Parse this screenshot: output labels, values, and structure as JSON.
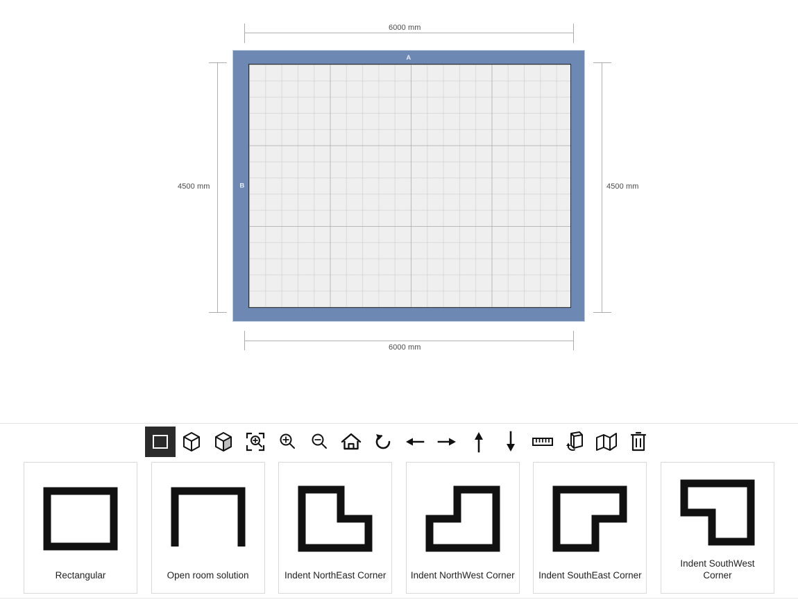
{
  "plan": {
    "dimensions": {
      "top": "6000 mm",
      "bottom": "6000 mm",
      "left": "4500 mm",
      "right": "4500 mm"
    },
    "wall_labels": {
      "top": "A",
      "left": "B"
    },
    "colors": {
      "wall": "#6d88b2",
      "floor": "#efefef",
      "outline": "#2a2d33",
      "dimension_line": "#b0b0b0",
      "dimension_text": "#4a4a4a"
    }
  },
  "toolbar": {
    "items": [
      {
        "name": "2d-view-icon",
        "title": "2D View",
        "active": true
      },
      {
        "name": "3d-wireframe-icon",
        "title": "3D Wireframe",
        "active": false
      },
      {
        "name": "3d-solid-icon",
        "title": "3D Solid",
        "active": false
      },
      {
        "name": "zoom-to-fit-icon",
        "title": "Zoom To Fit",
        "active": false
      },
      {
        "name": "zoom-in-icon",
        "title": "Zoom In",
        "active": false
      },
      {
        "name": "zoom-out-icon",
        "title": "Zoom Out",
        "active": false
      },
      {
        "name": "home-icon",
        "title": "Home View",
        "active": false
      },
      {
        "name": "rotate-icon",
        "title": "Rotate",
        "active": false
      },
      {
        "name": "arrow-left-icon",
        "title": "Move Left",
        "active": false
      },
      {
        "name": "arrow-right-icon",
        "title": "Move Right",
        "active": false
      },
      {
        "name": "arrow-up-icon",
        "title": "Move Up",
        "active": false
      },
      {
        "name": "arrow-down-icon",
        "title": "Move Down",
        "active": false
      },
      {
        "name": "ruler-icon",
        "title": "Measure",
        "active": false
      },
      {
        "name": "flip-object-icon",
        "title": "Flip Object",
        "active": false
      },
      {
        "name": "unfold-walls-icon",
        "title": "Unfold Walls",
        "active": false
      },
      {
        "name": "trash-icon",
        "title": "Delete",
        "active": false
      }
    ]
  },
  "palette": {
    "shapes": [
      {
        "name": "rectangular",
        "label": "Rectangular",
        "glyph": "rect"
      },
      {
        "name": "open-room-solution",
        "label": "Open room solution",
        "glyph": "open"
      },
      {
        "name": "indent-northeast-corner",
        "label": "Indent NorthEast Corner",
        "glyph": "indent-ne"
      },
      {
        "name": "indent-northwest-corner",
        "label": "Indent NorthWest Corner",
        "glyph": "indent-nw"
      },
      {
        "name": "indent-southeast-corner",
        "label": "Indent SouthEast Corner",
        "glyph": "indent-se"
      },
      {
        "name": "indent-southwest-corner",
        "label": "Indent SouthWest Corner",
        "glyph": "indent-sw"
      }
    ]
  }
}
